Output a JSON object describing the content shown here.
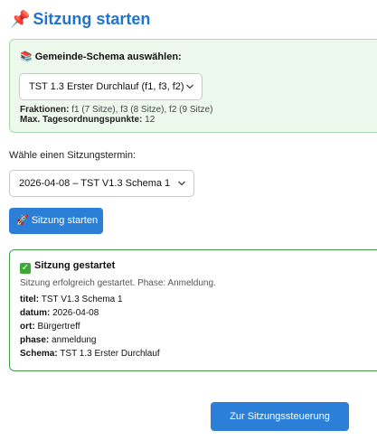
{
  "header": {
    "title": "Sitzung starten",
    "title_icon": "pin-icon"
  },
  "schema_panel": {
    "heading": "Gemeinde-Schema auswählen:",
    "heading_icon": "books-icon",
    "selected_schema": "TST 1.3 Erster Durchlauf (f1, f3, f2)",
    "fraktionen_label": "Fraktionen:",
    "fraktionen_value": "f1 (7 Sitze), f3 (8 Sitze), f2 (9 Sitze)",
    "max_top_label": "Max. Tagesordnungspunkte:",
    "max_top_value": "12"
  },
  "termin": {
    "label": "Wähle einen Sitzungstermin:",
    "selected": "2026-04-08 – TST V1.3 Schema 1"
  },
  "start_button": {
    "label": "Sitzung starten",
    "icon": "rocket-icon"
  },
  "result": {
    "heading": "Sitzung gestartet",
    "heading_icon": "check-icon",
    "message": "Sitzung erfolgreich gestartet. Phase: Anmeldung.",
    "details": [
      {
        "key": "titel:",
        "value": "TST V1.3 Schema 1"
      },
      {
        "key": "datum:",
        "value": "2026-04-08"
      },
      {
        "key": "ort:",
        "value": "Bürgertreff"
      },
      {
        "key": "phase:",
        "value": "anmeldung"
      },
      {
        "key": "Schema:",
        "value": "TST 1.3 Erster Durchlauf"
      }
    ]
  },
  "control_button": {
    "label": "Zur Sitzungssteuerung"
  },
  "colors": {
    "accent": "#2b7fd6",
    "title": "#1f73d1",
    "success_border": "#3f9a4a",
    "schema_bg": "#eef9ee"
  }
}
